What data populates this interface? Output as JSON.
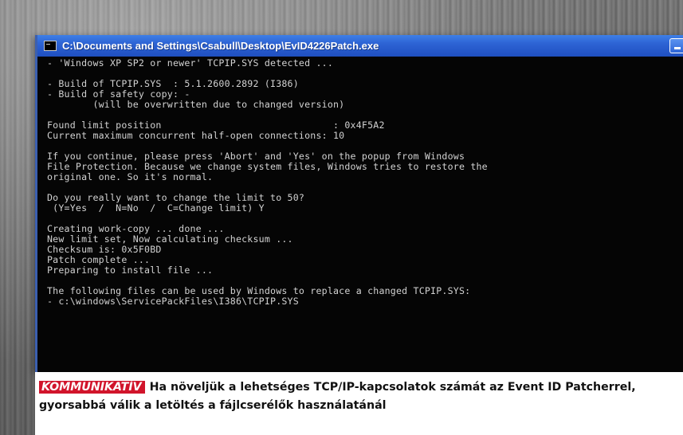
{
  "window": {
    "title": "C:\\Documents and Settings\\Csabull\\Desktop\\EvID4226Patch.exe"
  },
  "console": {
    "lines": [
      "- 'Windows XP SP2 or newer' TCPIP.SYS detected ...",
      "",
      "- Build of TCPIP.SYS  : 5.1.2600.2892 (I386)",
      "- Build of safety copy: -",
      "        (will be overwritten due to changed version)",
      "",
      "Found limit position                              : 0x4F5A2",
      "Current maximum concurrent half-open connections: 10",
      "",
      "If you continue, please press 'Abort' and 'Yes' on the popup from Windows",
      "File Protection. Because we change system files, Windows tries to restore the",
      "original one. So it's normal.",
      "",
      "Do you really want to change the limit to 50?",
      " (Y=Yes  /  N=No  /  C=Change limit) Y",
      "",
      "Creating work-copy ... done ...",
      "New limit set, Now calculating checksum ...",
      "Checksum is: 0x5F0BD",
      "Patch complete ...",
      "Preparing to install file ...",
      "",
      "The following files can be used by Windows to replace a changed TCPIP.SYS:",
      "- c:\\windows\\ServicePackFiles\\I386\\TCPIP.SYS"
    ]
  },
  "caption": {
    "tag": "KOMMUNIKATÍV",
    "text": "Ha növeljük a lehetséges TCP/IP-kapcsolatok számát az Event ID Patcherrel, gyorsabbá válik a letöltés a fájlcserélők használatánál"
  },
  "colors": {
    "titlebar": "#2d63d4",
    "console_bg": "#050505",
    "console_text": "#d2d2d2",
    "caption_tag": "#d1142b"
  }
}
